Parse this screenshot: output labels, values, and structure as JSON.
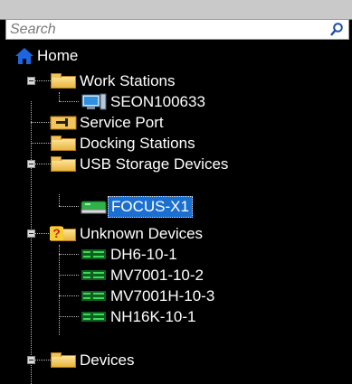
{
  "search": {
    "placeholder": "Search"
  },
  "tree": {
    "home": "Home",
    "work_stations": "Work Stations",
    "seon": "SEON100633",
    "service_port": "Service Port",
    "docking_stations": "Docking Stations",
    "usb_storage": "USB Storage Devices",
    "focus": "FOCUS-X1",
    "unknown_devices": "Unknown Devices",
    "unknown_children": [
      "DH6-10-1",
      "MV7001-10-2",
      "MV7001H-10-3",
      "NH16K-10-1"
    ],
    "devices": "Devices"
  },
  "colors": {
    "selection": "#1b6fd1",
    "folder": "#f2c65a",
    "device_green": "#2db34a",
    "home_blue": "#1d66e0"
  }
}
